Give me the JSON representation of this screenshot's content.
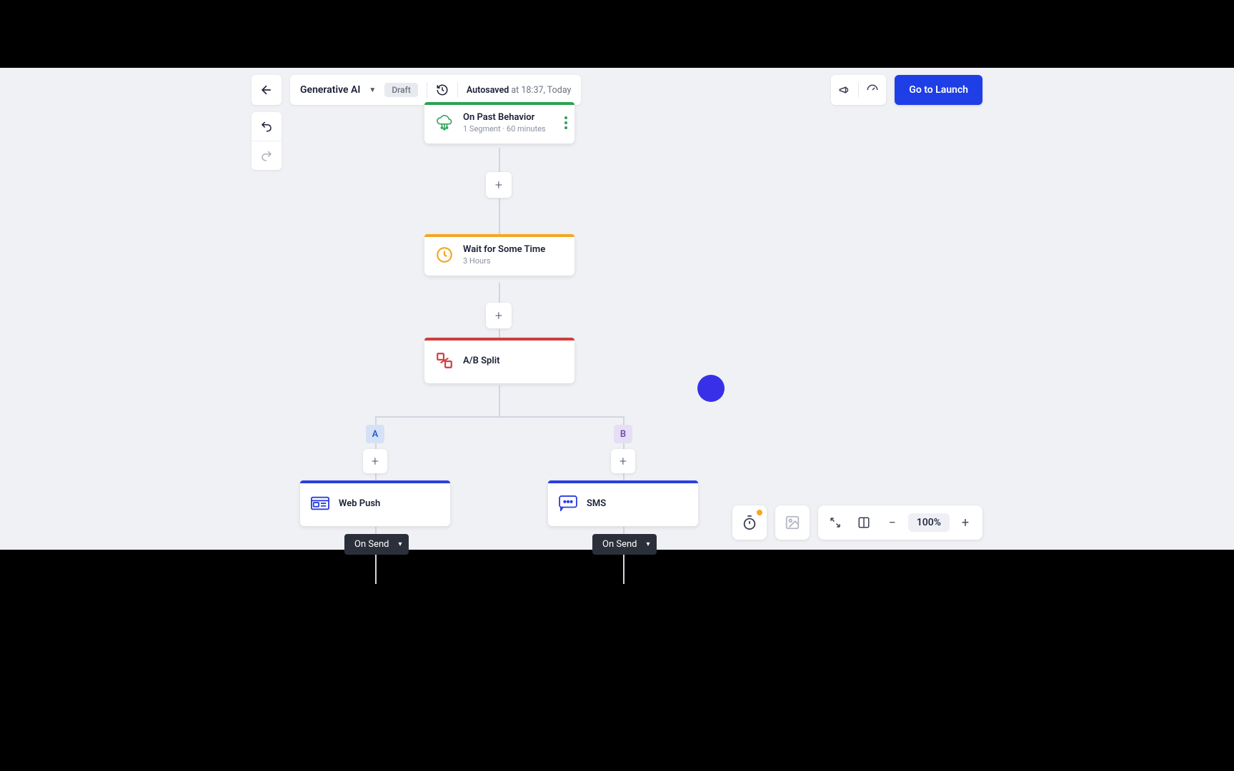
{
  "header": {
    "journey_name": "Generative AI",
    "status_badge": "Draft",
    "autosave_label": "Autosaved",
    "autosave_detail": "at 18:37, Today",
    "launch_button": "Go to Launch"
  },
  "nodes": {
    "past_behavior": {
      "title": "On Past Behavior",
      "subtitle": "1 Segment · 60 minutes",
      "accent": "#2aa352"
    },
    "wait": {
      "title": "Wait for Some Time",
      "subtitle": "3 Hours",
      "accent": "#f5a623"
    },
    "ab_split": {
      "title": "A/B Split",
      "accent": "#d23b3b"
    },
    "web_push": {
      "title": "Web Push",
      "accent": "#2b3fe0"
    },
    "sms": {
      "title": "SMS",
      "accent": "#2b3fe0"
    }
  },
  "branches": {
    "a": "A",
    "b": "B"
  },
  "on_send_label": "On Send",
  "zoom": {
    "value": "100%"
  }
}
